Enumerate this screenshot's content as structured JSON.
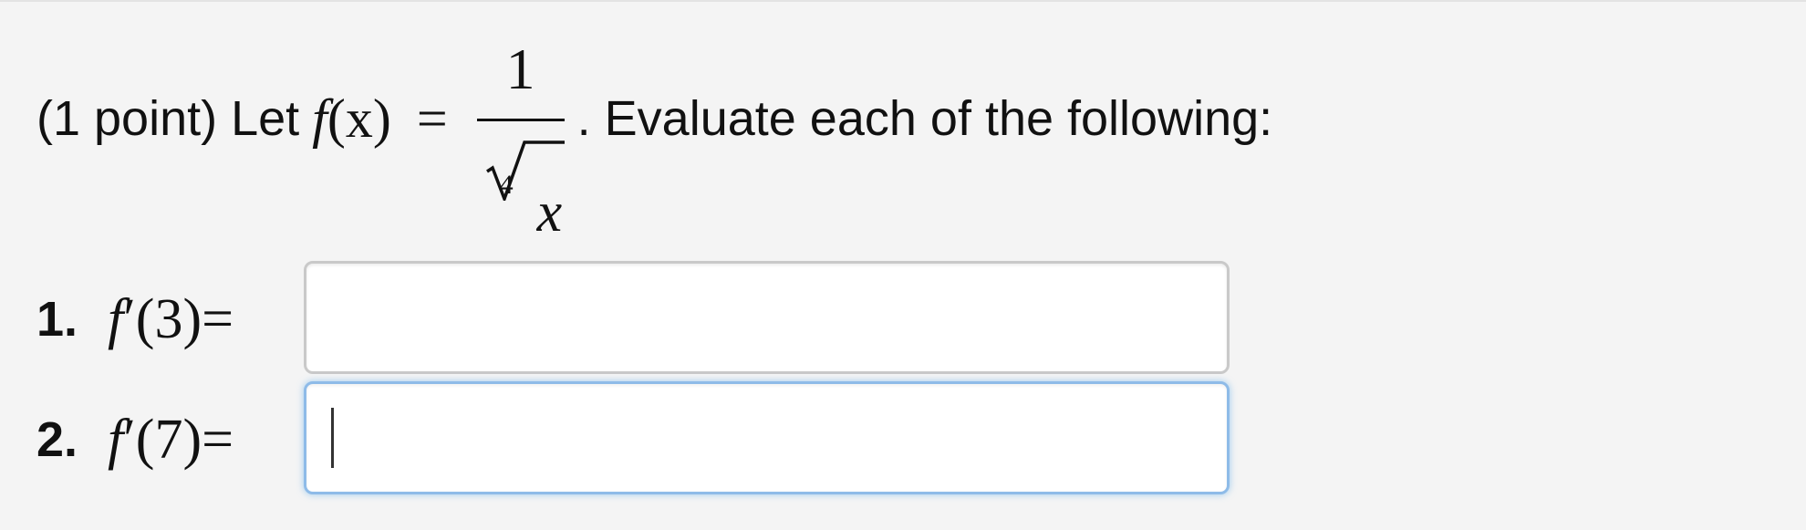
{
  "problem": {
    "prefix": "(1 point) Let",
    "function_lhs_f": "f",
    "function_lhs_arg": "(x)",
    "equals": "=",
    "numerator": "1",
    "root_index": "4",
    "radicand": "x",
    "suffix": ". Evaluate each of the following:"
  },
  "parts": [
    {
      "number": "1.",
      "f": "f",
      "prime": "′",
      "arg": "(3)",
      "equals": "=",
      "value": "",
      "focused": false
    },
    {
      "number": "2.",
      "f": "f",
      "prime": "′",
      "arg": "(7)",
      "equals": "=",
      "value": "",
      "focused": true
    }
  ],
  "colors": {
    "background": "#f4f4f4",
    "input_border": "#c9c9c9",
    "focus_border": "#8ebbe8"
  }
}
